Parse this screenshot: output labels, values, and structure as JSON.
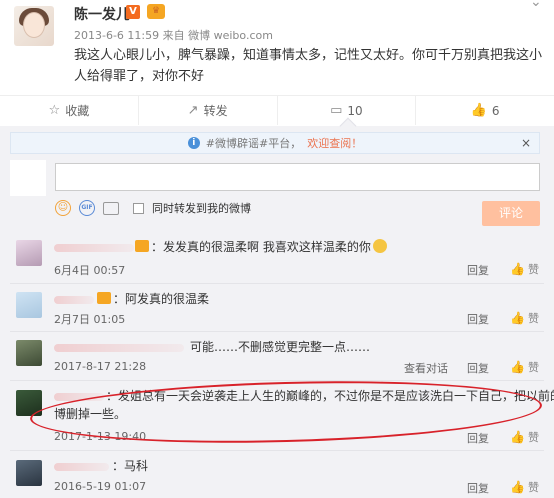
{
  "post": {
    "author": "陈一发儿",
    "vip_badge": "V",
    "meta": "2013-6-6 11:59 来自 微博 weibo.com",
    "text": "我这人心眼儿小，脾气暴躁，知道事情太多，记性又太好。你可千万别真把我这小人给得罪了，对你不好"
  },
  "actions": [
    {
      "icon": "star-icon",
      "glyph": "☆",
      "label": "收藏"
    },
    {
      "icon": "share-icon",
      "glyph": "↗",
      "label": "转发"
    },
    {
      "icon": "comment-icon",
      "glyph": "▭",
      "label": "10"
    },
    {
      "icon": "like-icon",
      "glyph": "👍",
      "label": "6"
    }
  ],
  "notice": {
    "prefix": "#微博辟谣#平台，",
    "welcome": "欢迎查阅！",
    "close": "×"
  },
  "composer": {
    "gif": "GIF",
    "forward_label": "同时转发到我的微博",
    "submit_label": "评论"
  },
  "comments": [
    {
      "text": "：发发真的很温柔啊 我喜欢这样温柔的你",
      "time": "6月4日 00:57",
      "reply": "回复",
      "like": "赞",
      "view": ""
    },
    {
      "text": "：阿发真的很温柔",
      "time": "2月7日 01:05",
      "reply": "回复",
      "like": "赞",
      "view": ""
    },
    {
      "text": "可能……不删感觉更完整一点……",
      "time": "2017-8-17 21:28",
      "reply": "回复",
      "like": "赞",
      "view": "查看对话"
    },
    {
      "text": "：发姐总有一天会逆袭走上人生的巅峰的，不过你是不是应该洗白一下自己，把以前的微",
      "text2": "博删掉一些。",
      "time": "2017-1-13 19:40",
      "reply": "回复",
      "like": "赞",
      "view": ""
    },
    {
      "text": "：马科",
      "time": "2016-5-19 01:07",
      "reply": "回复",
      "like": "赞",
      "view": ""
    }
  ],
  "colors": {
    "accent": "#eb7350",
    "submit": "#ffc09f",
    "highlight": "#d8222a"
  }
}
